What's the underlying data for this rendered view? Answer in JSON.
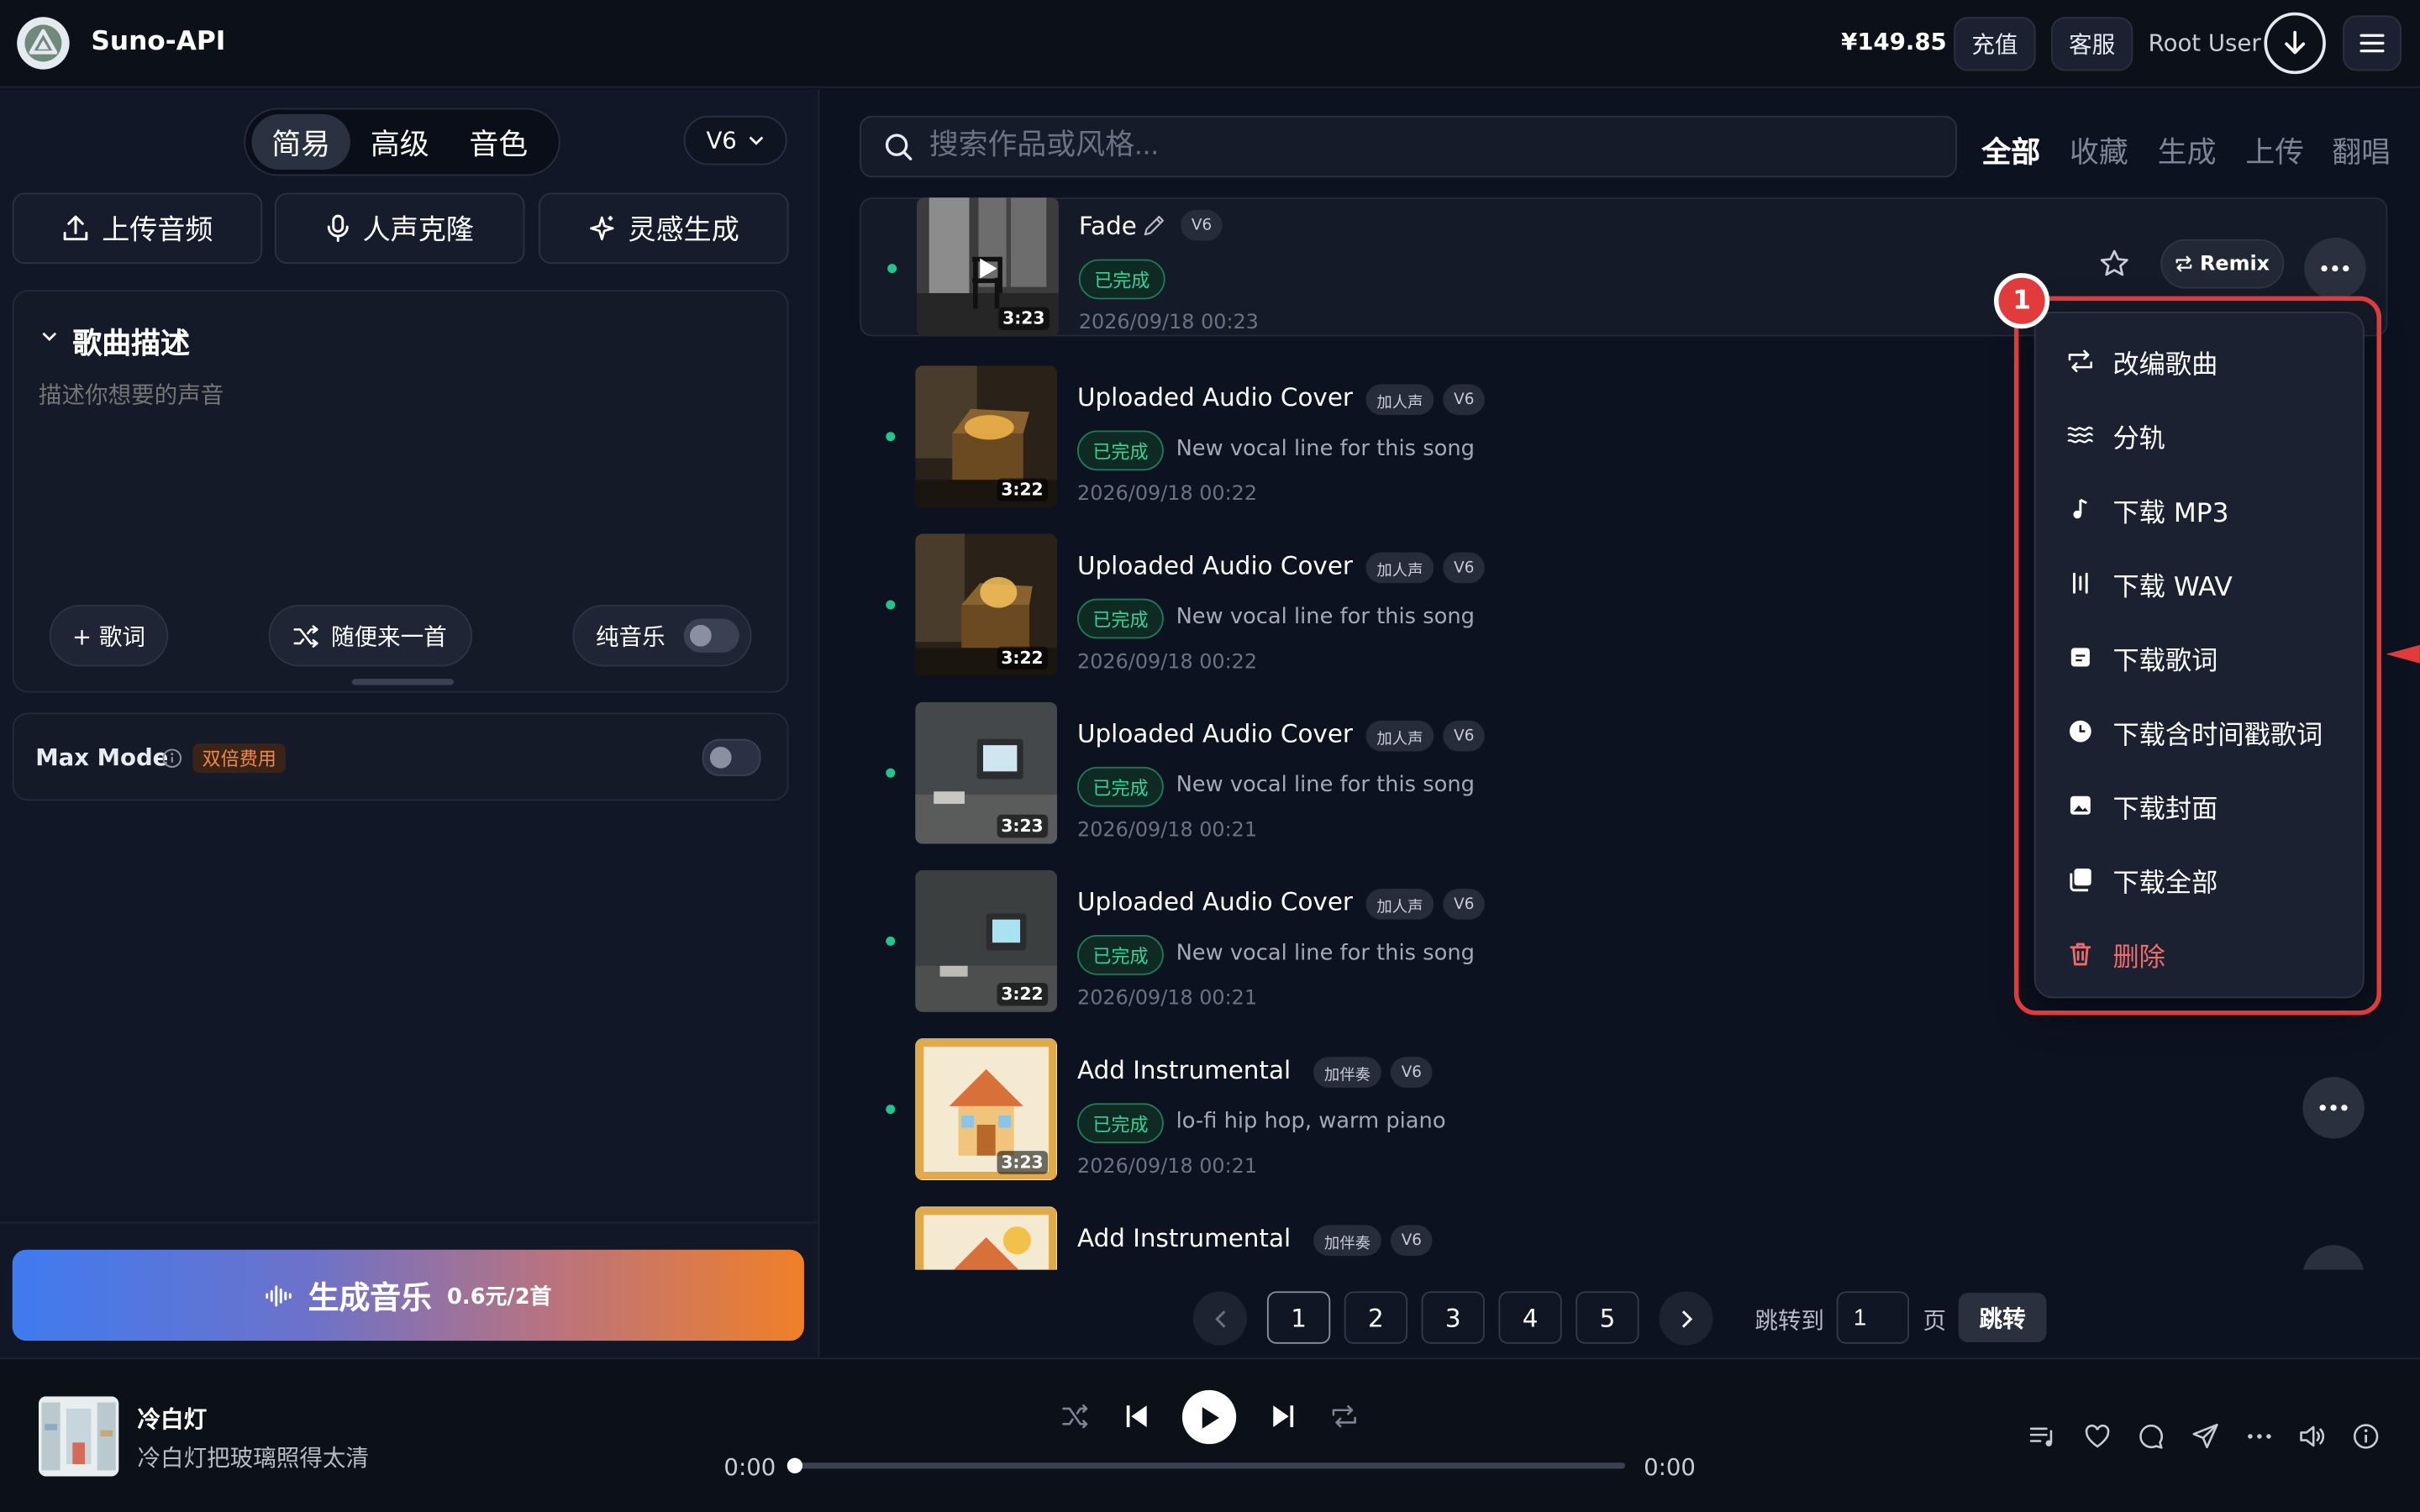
{
  "app": {
    "title": "Suno-API"
  },
  "header": {
    "balance": "¥149.85",
    "recharge": "充值",
    "support": "客服",
    "user": "Root User"
  },
  "left": {
    "modes": [
      "简易",
      "高级",
      "音色"
    ],
    "version": "V6",
    "actions": {
      "upload": "上传音频",
      "clone": "人声克隆",
      "inspire": "灵感生成"
    },
    "desc": {
      "title": "歌曲描述",
      "placeholder": "描述你想要的声音"
    },
    "lyrics_btn": "+ 歌词",
    "random_btn": "随便来一首",
    "instrumental": "纯音乐",
    "max_mode": "Max Mode",
    "max_badge": "双倍费用",
    "generate": {
      "label": "生成音乐",
      "price": "0.6元/2首"
    }
  },
  "search": {
    "placeholder": "搜索作品或风格..."
  },
  "filters": [
    "全部",
    "收藏",
    "生成",
    "上传",
    "翻唱"
  ],
  "songs": [
    {
      "title": "Fade",
      "tags": [
        "V6"
      ],
      "status": "已完成",
      "desc": "",
      "date": "2026/09/18 00:23",
      "duration": "3:23"
    },
    {
      "title": "Uploaded Audio Cover",
      "tags": [
        "加人声",
        "V6"
      ],
      "status": "已完成",
      "desc": "New vocal line for this song",
      "date": "2026/09/18 00:22",
      "duration": "3:22"
    },
    {
      "title": "Uploaded Audio Cover",
      "tags": [
        "加人声",
        "V6"
      ],
      "status": "已完成",
      "desc": "New vocal line for this song",
      "date": "2026/09/18 00:22",
      "duration": "3:22"
    },
    {
      "title": "Uploaded Audio Cover",
      "tags": [
        "加人声",
        "V6"
      ],
      "status": "已完成",
      "desc": "New vocal line for this song",
      "date": "2026/09/18 00:21",
      "duration": "3:23"
    },
    {
      "title": "Uploaded Audio Cover",
      "tags": [
        "加人声",
        "V6"
      ],
      "status": "已完成",
      "desc": "New vocal line for this song",
      "date": "2026/09/18 00:21",
      "duration": "3:22"
    },
    {
      "title": "Add Instrumental",
      "tags": [
        "加伴奏",
        "V6"
      ],
      "status": "已完成",
      "desc": "lo-fi hip hop, warm piano",
      "date": "2026/09/18 00:21",
      "duration": "3:23"
    },
    {
      "title": "Add Instrumental",
      "tags": [
        "加伴奏",
        "V6"
      ],
      "status": "",
      "desc": "",
      "date": "",
      "duration": ""
    }
  ],
  "row_actions": {
    "remix": "Remix"
  },
  "menu": {
    "badge": "1",
    "items": [
      "改编歌曲",
      "分轨",
      "下载 MP3",
      "下载 WAV",
      "下载歌词",
      "下载含时间戳歌词",
      "下载封面",
      "下载全部",
      "删除"
    ]
  },
  "pagination": {
    "pages": [
      "1",
      "2",
      "3",
      "4",
      "5"
    ],
    "current": "1",
    "jump_label": "跳转到",
    "jump_value": "1",
    "page_unit": "页",
    "jump_btn": "跳转"
  },
  "player": {
    "title": "冷白灯",
    "subtitle": "冷白灯把玻璃照得太清",
    "time_current": "0:00",
    "time_total": "0:00",
    "progress": 0
  }
}
